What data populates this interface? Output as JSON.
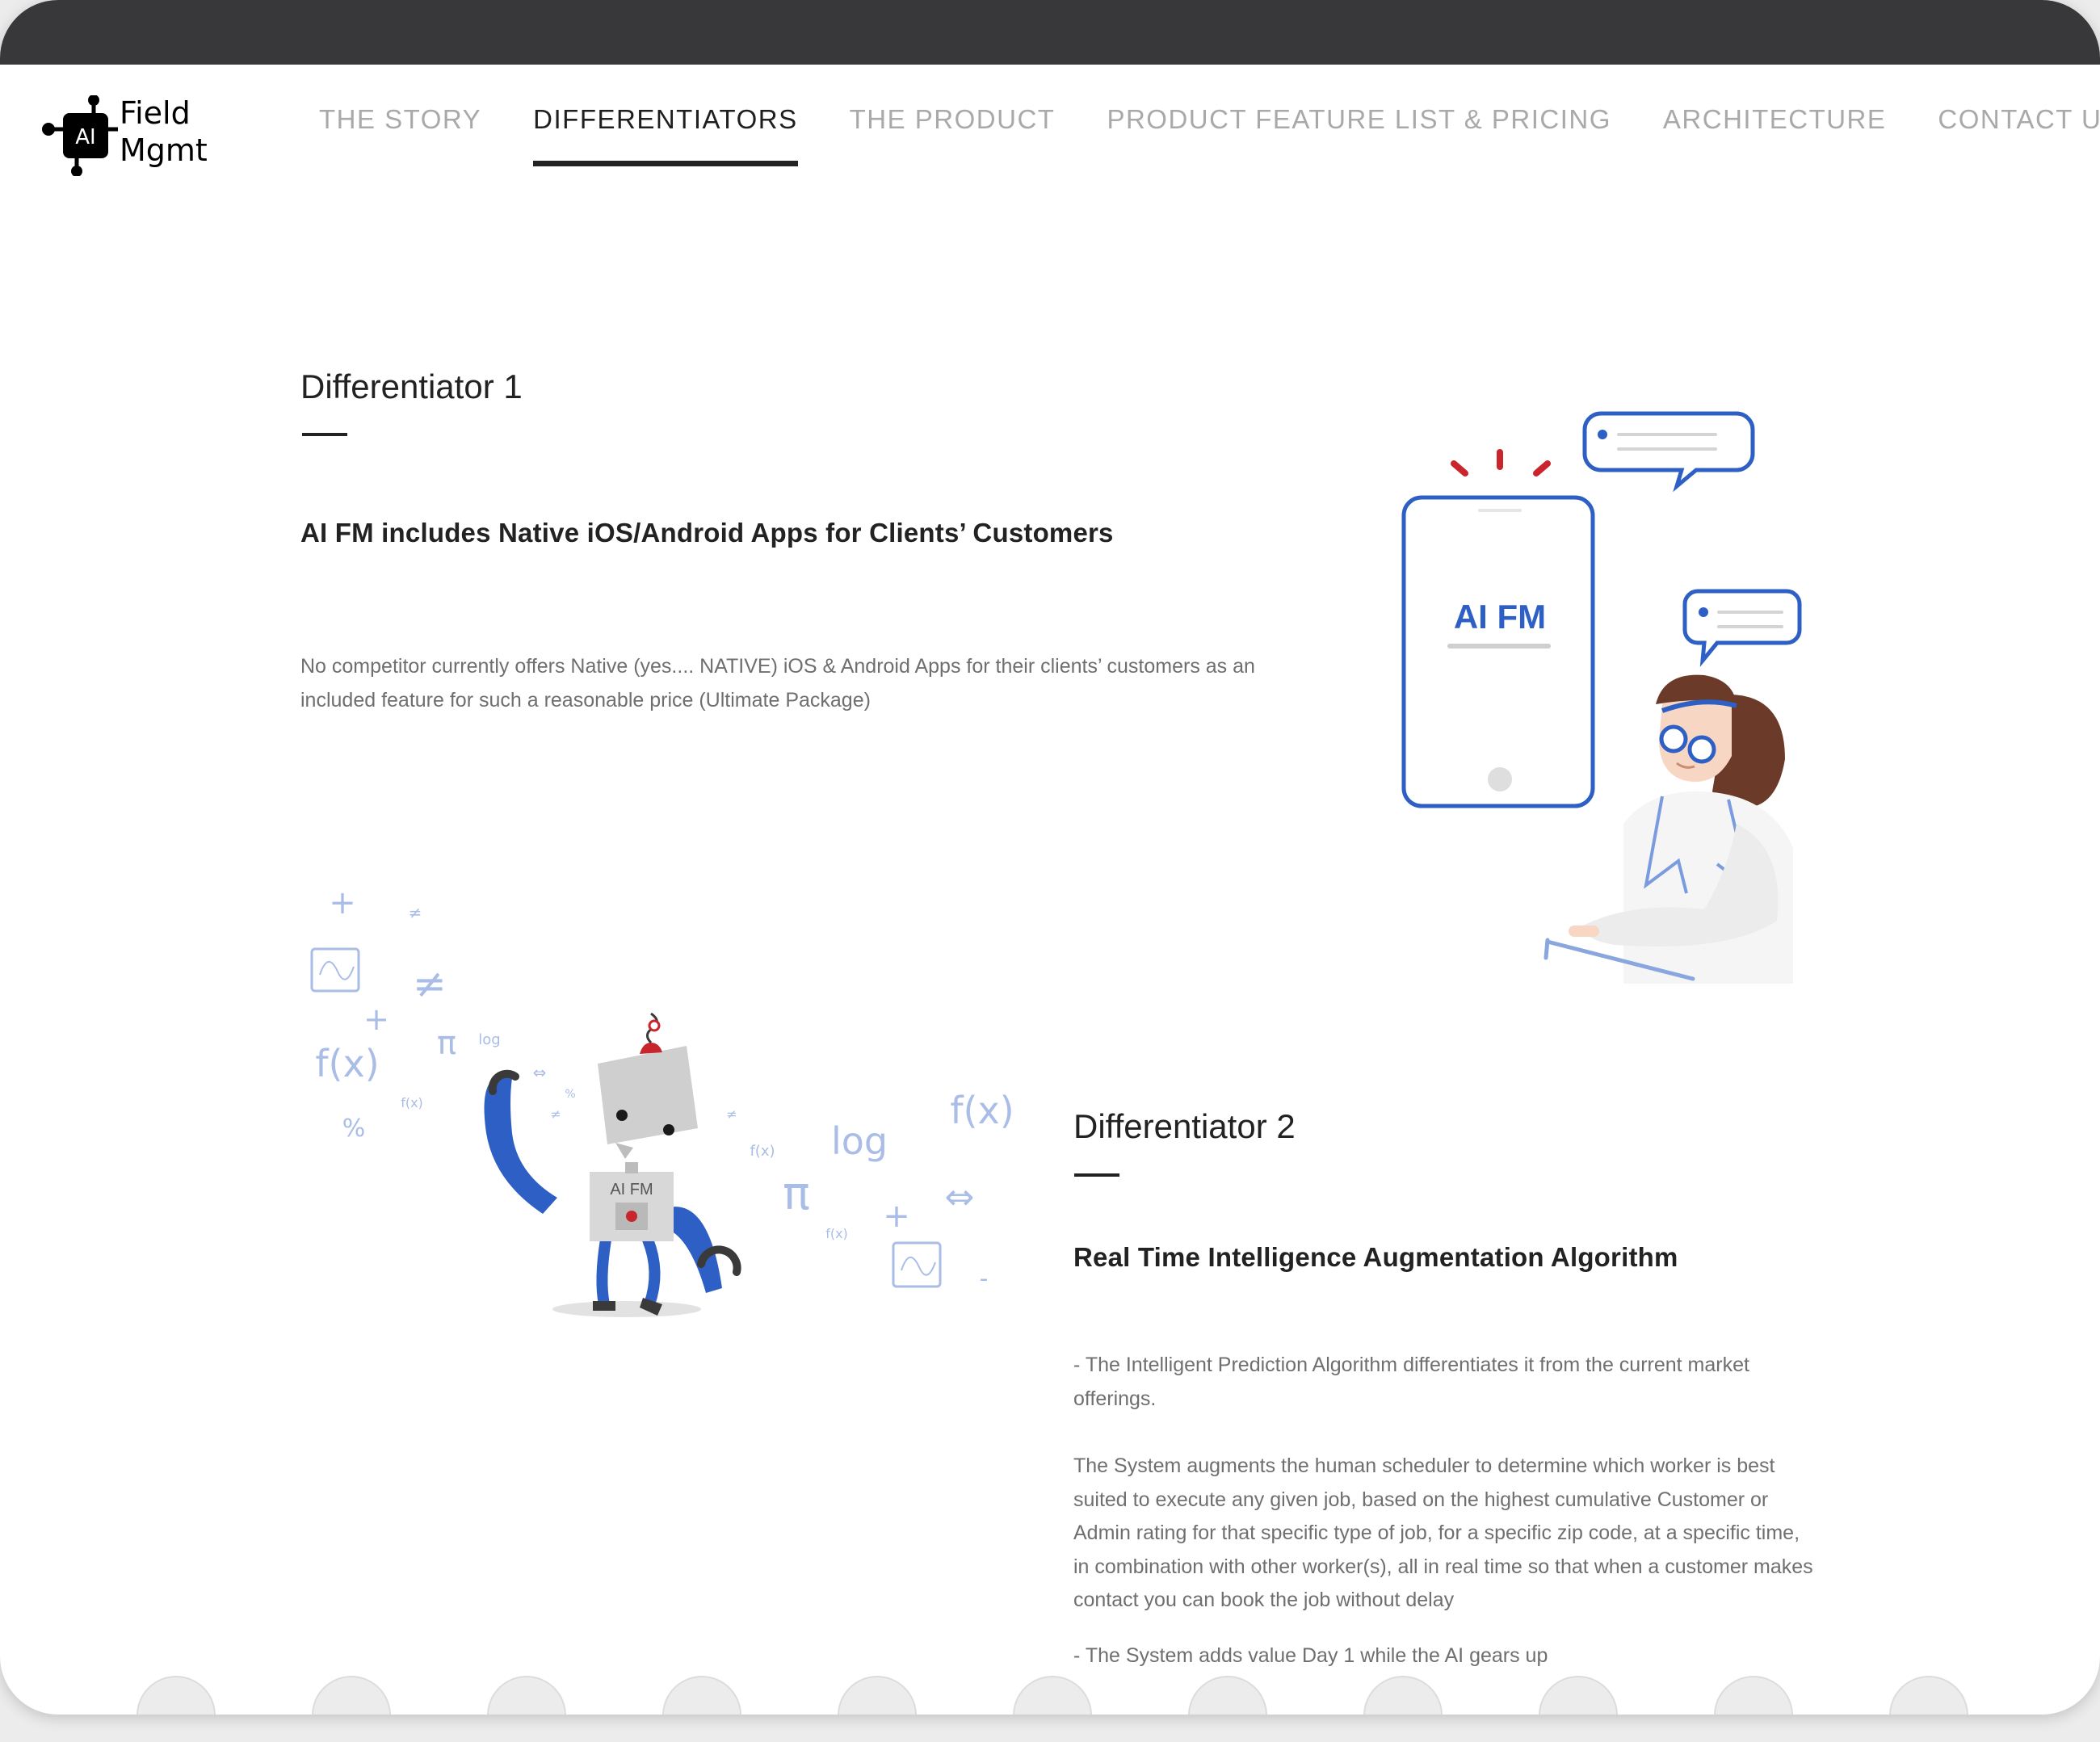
{
  "logo": {
    "badge": "AI",
    "line1": "Field",
    "line2": "Mgmt"
  },
  "nav": {
    "items": [
      {
        "label": "THE STORY",
        "active": false
      },
      {
        "label": "DIFFERENTIATORS",
        "active": true
      },
      {
        "label": "THE PRODUCT",
        "active": false
      },
      {
        "label": "PRODUCT FEATURE LIST & PRICING",
        "active": false
      },
      {
        "label": "ARCHITECTURE",
        "active": false
      },
      {
        "label": "CONTACT US",
        "active": false
      }
    ]
  },
  "differentiator1": {
    "title": "Differentiator 1",
    "subtitle": "AI FM includes Native iOS/Android Apps for Clients’ Customers",
    "body": "No competitor currently offers Native (yes.... NATIVE) iOS & Android Apps for their clients’ customers as an included feature for such a reasonable price (Ultimate Package)",
    "phone_label": "AI FM"
  },
  "differentiator2": {
    "title": "Differentiator 2",
    "subtitle": "Real Time Intelligence Augmentation Algorithm",
    "para1": "- The Intelligent Prediction Algorithm differentiates it from the current market offerings.",
    "para2": "The System augments the human scheduler to determine which worker is best suited to execute any given job, based on the highest cumulative Customer or Admin rating for that specific type of job, for a specific zip code, at a specific time, in combination with other worker(s), all in real time so that when a customer makes contact you can book the job without delay",
    "para3": "- The System adds value Day 1 while the AI gears up",
    "robot_label": "AI FM"
  },
  "math_symbols": {
    "plus": "+",
    "not_equal": "≠",
    "fx": "f(x)",
    "pi": "π",
    "log": "log",
    "percent": "%",
    "arrows": "⇔",
    "minus": "-"
  },
  "colors": {
    "titlebar": "#38383b",
    "accent_blue": "#2d5fc4",
    "text_dark": "#222222",
    "text_body": "#6f6f6f",
    "nav_inactive": "#a9a9a9",
    "alert_red": "#c9252c"
  }
}
